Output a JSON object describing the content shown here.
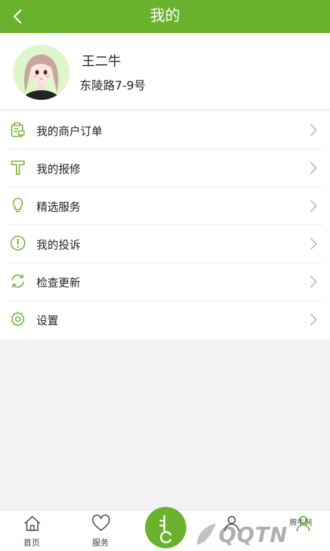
{
  "header": {
    "title": "我的",
    "back_icon": "chevron-left-icon"
  },
  "profile": {
    "name": "王二牛",
    "address": "东陵路7-9号",
    "avatar_icon": "avatar-girl"
  },
  "menu": [
    {
      "label": "我的商户订单",
      "icon": "merchant-order-icon"
    },
    {
      "label": "我的报修",
      "icon": "repair-hammer-icon"
    },
    {
      "label": "精选服务",
      "icon": "lightbulb-icon"
    },
    {
      "label": "我的投诉",
      "icon": "complaint-icon"
    },
    {
      "label": "检查更新",
      "icon": "refresh-icon"
    },
    {
      "label": "设置",
      "icon": "gear-icon"
    }
  ],
  "tabbar": {
    "tabs": [
      {
        "label": "首页",
        "icon": "home-icon"
      },
      {
        "label": "服务",
        "icon": "heart-icon"
      },
      {
        "label": "",
        "icon": "key-icon"
      },
      {
        "label": "",
        "icon": "user-icon"
      },
      {
        "label": "",
        "icon": "profile-icon"
      }
    ]
  },
  "watermark": {
    "site": "腾牛网",
    "logo": "QQTN"
  },
  "colors": {
    "accent": "#6ab12d",
    "background": "#f2f2f4",
    "text": "#222222"
  }
}
